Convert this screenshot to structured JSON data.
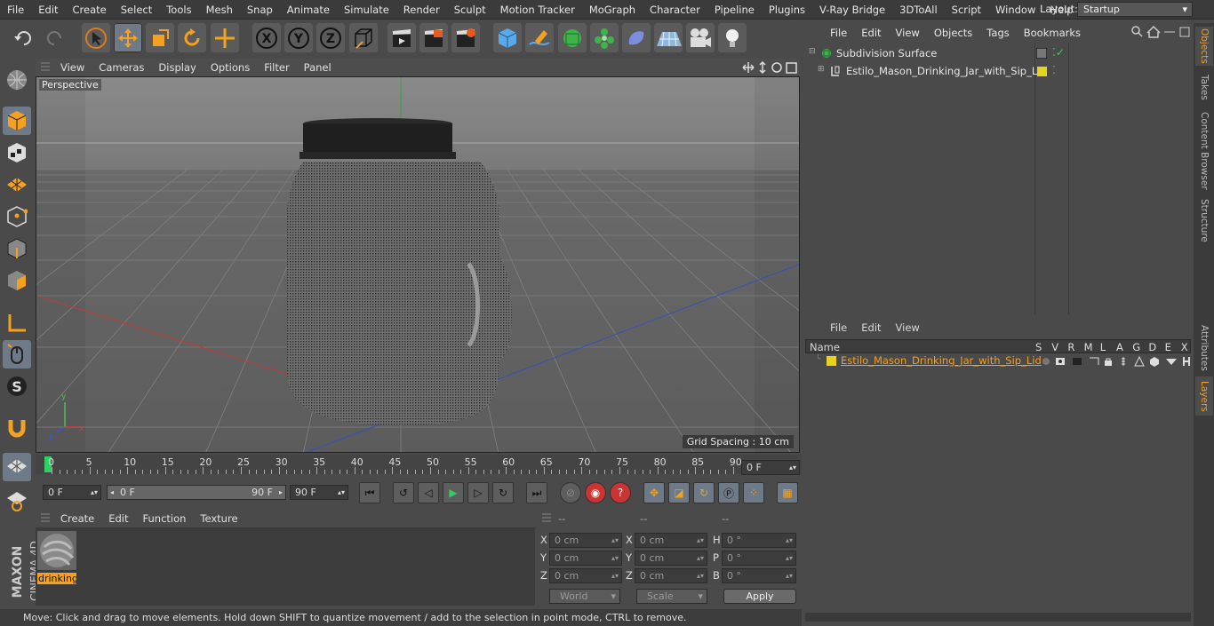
{
  "menubar": {
    "items": [
      "File",
      "Edit",
      "Create",
      "Select",
      "Tools",
      "Mesh",
      "Snap",
      "Animate",
      "Simulate",
      "Render",
      "Sculpt",
      "Motion Tracker",
      "MoGraph",
      "Character",
      "Pipeline",
      "Plugins",
      "V-Ray Bridge",
      "3DToAll",
      "Script",
      "Window",
      "Help"
    ],
    "layout_label": "Layout:",
    "layout_value": "Startup"
  },
  "viewport": {
    "menu": [
      "View",
      "Cameras",
      "Display",
      "Options",
      "Filter",
      "Panel"
    ],
    "label": "Perspective",
    "grid_spacing": "Grid Spacing : 10 cm"
  },
  "timeline": {
    "ticks": [
      "0",
      "5",
      "10",
      "15",
      "20",
      "25",
      "30",
      "35",
      "40",
      "45",
      "50",
      "55",
      "60",
      "65",
      "70",
      "75",
      "80",
      "85",
      "90"
    ],
    "current_frame": "0 F",
    "start_field": "0 F",
    "range_start": "0 F",
    "range_end": "90 F",
    "end_field": "90 F"
  },
  "material": {
    "menu": [
      "Create",
      "Edit",
      "Function",
      "Texture"
    ],
    "item_label": "drinking"
  },
  "coords": {
    "headers": [
      "--",
      "--",
      "--"
    ],
    "rows": [
      {
        "a": "X",
        "av": "0 cm",
        "b": "X",
        "bv": "0 cm",
        "c": "H",
        "cv": "0 °"
      },
      {
        "a": "Y",
        "av": "0 cm",
        "b": "Y",
        "bv": "0 cm",
        "c": "P",
        "cv": "0 °"
      },
      {
        "a": "Z",
        "av": "0 cm",
        "b": "Z",
        "bv": "0 cm",
        "c": "B",
        "cv": "0 °"
      }
    ],
    "world": "World",
    "scale": "Scale",
    "apply": "Apply"
  },
  "objects": {
    "menu": [
      "File",
      "Edit",
      "View",
      "Objects",
      "Tags",
      "Bookmarks"
    ],
    "items": [
      {
        "name": "Subdivision Surface"
      },
      {
        "name": "Estilo_Mason_Drinking_Jar_with_Sip_Lid"
      }
    ]
  },
  "layers": {
    "menu": [
      "File",
      "Edit",
      "View"
    ],
    "col_name": "Name",
    "cols": [
      "S",
      "V",
      "R",
      "M",
      "L",
      "A",
      "G",
      "D",
      "E",
      "X"
    ],
    "row_name": "Estilo_Mason_Drinking_Jar_with_Sip_Lid"
  },
  "right_tabs": [
    "Objects",
    "Takes",
    "Content Browser",
    "Structure",
    "Attributes",
    "Layers"
  ],
  "status": "Move: Click and drag to move elements. Hold down SHIFT to quantize movement / add to the selection in point mode, CTRL to remove.",
  "brand": [
    "MAXON",
    "CINEMA 4D"
  ],
  "colors": {
    "accent": "#f4a020",
    "selected_tool": "#6e7a88",
    "layer_color": "#e8d21a"
  }
}
